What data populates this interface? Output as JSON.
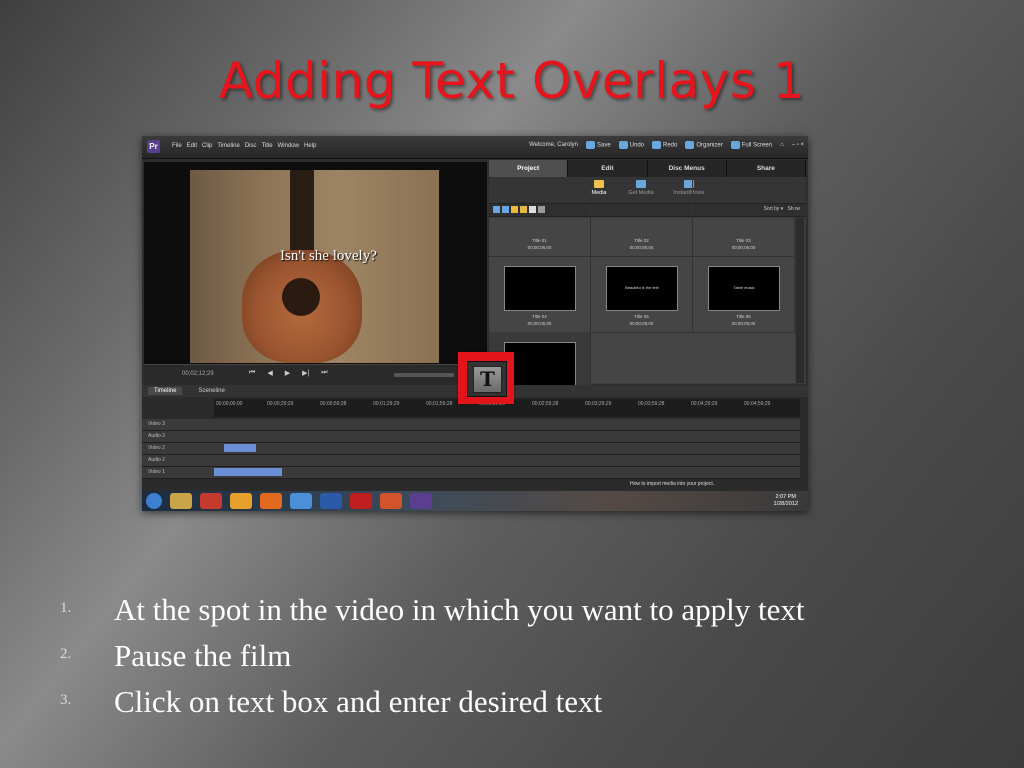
{
  "slide": {
    "title": "Adding Text Overlays 1"
  },
  "app": {
    "logo": "Pr",
    "menu": [
      "File",
      "Edit",
      "Clip",
      "Timeline",
      "Disc",
      "Title",
      "Window",
      "Help"
    ],
    "welcome": "Welcome, Carolyn",
    "toolbar": [
      "Save",
      "Undo",
      "Redo",
      "Organizer",
      "Full Screen"
    ],
    "window_controls": "– ▫ ×"
  },
  "preview": {
    "overlay_text": "Isn't she lovely?",
    "timecode": "00;02;12;29"
  },
  "panel": {
    "tabs": [
      "Project",
      "Edit",
      "Disc Menus",
      "Share"
    ],
    "active_tab": "Project",
    "subtabs": [
      "Media",
      "Get Media",
      "InstantMovie"
    ],
    "sort_label": "Sort by",
    "show_label": "Show",
    "cells": [
      {
        "title": "Title 01",
        "duration": "00;00;05;00"
      },
      {
        "title": "Title 02",
        "duration": "00;00;05;00"
      },
      {
        "title": "Title 03",
        "duration": "00;00;05;00"
      },
      {
        "title": "Title 04",
        "duration": "00;00;05;00",
        "thumb": ""
      },
      {
        "title": "Title 05",
        "duration": "00;00;05;00",
        "thumb": "Beautiful is the feel"
      },
      {
        "title": "Title 06",
        "duration": "00;00;05;00",
        "thumb": "Table music"
      }
    ]
  },
  "timeline": {
    "tabs": [
      "Timeline",
      "Sceneline"
    ],
    "ruler": [
      "00;00;00;00",
      "00;00;29;29",
      "00;00;59;28",
      "00;01;29;29",
      "00;01;59;28",
      "00;02;29;29",
      "00;02;59;28",
      "00;03;29;29",
      "00;03;59;28",
      "00;04;29;29",
      "00;04;59;29"
    ],
    "tracks": [
      "Video 3",
      "Audio 3",
      "Video 2",
      "Audio 2",
      "Video 1"
    ],
    "tip": "How to import media into your project."
  },
  "taskbar": {
    "time": "2:07 PM",
    "date": "1/28/2012"
  },
  "highlight": {
    "glyph": "T"
  },
  "steps": [
    {
      "num": "1.",
      "text": "At the spot in the video in which you want to apply text"
    },
    {
      "num": "2.",
      "text": "Pause the film"
    },
    {
      "num": "3.",
      "text": "Click on text box and enter desired text"
    }
  ]
}
